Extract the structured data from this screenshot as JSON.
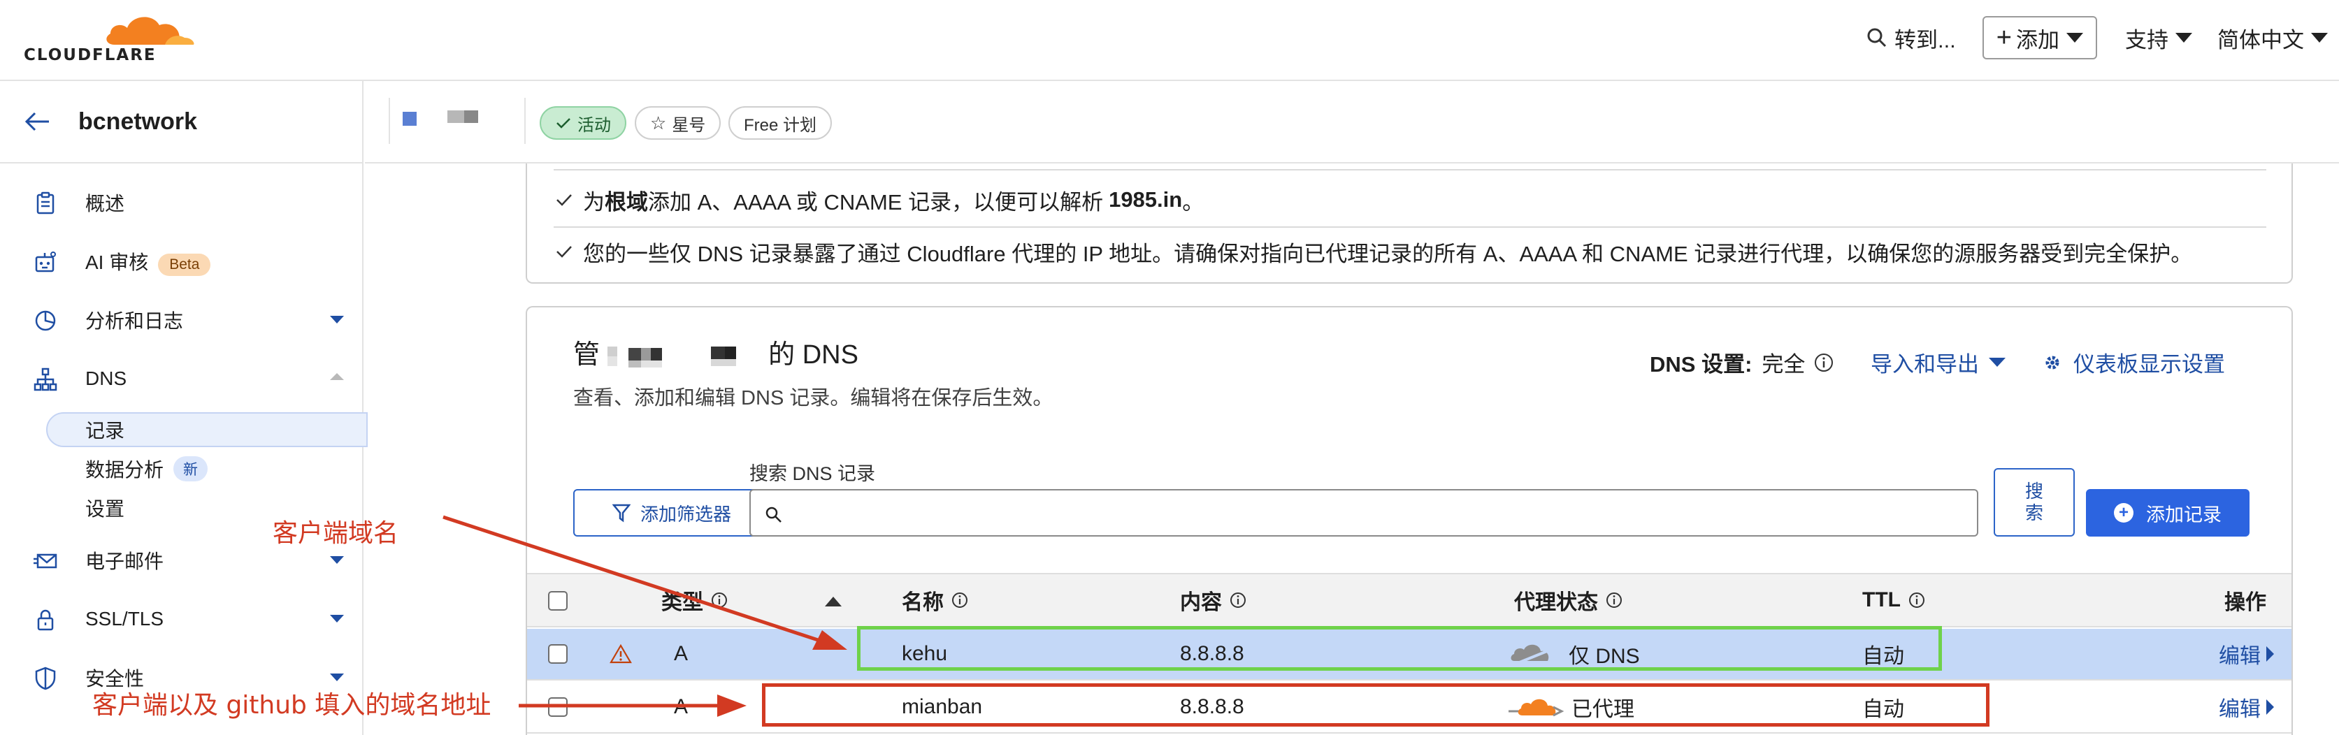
{
  "header": {
    "logo_text": "CLOUDFLARE",
    "goto_label": "转到...",
    "add_label": "添加",
    "support_label": "支持",
    "language_label": "简体中文",
    "colors": {
      "brand_orange": "#f38020",
      "link_blue": "#1f4ea3",
      "primary_button": "#2c64e0"
    }
  },
  "sidebar": {
    "account_name": "bcnetwork",
    "items": [
      {
        "label": "概述",
        "icon": "clipboard-icon"
      },
      {
        "label": "AI 审核",
        "icon": "robot-icon",
        "badge": "Beta"
      },
      {
        "label": "分析和日志",
        "icon": "pie-chart-icon"
      },
      {
        "label": "DNS",
        "icon": "network-icon"
      },
      {
        "label": "电子邮件",
        "icon": "envelope-icon"
      },
      {
        "label": "SSL/TLS",
        "icon": "lock-icon"
      },
      {
        "label": "安全性",
        "icon": "shield-icon"
      }
    ],
    "dns_sub": [
      {
        "label": "记录"
      },
      {
        "label": "数据分析",
        "badge": "新"
      },
      {
        "label": "设置"
      }
    ]
  },
  "zone": {
    "status_label": "活动",
    "star_label": "星号",
    "plan_label": "Free 计划"
  },
  "info": {
    "line1_pre": "为",
    "line1_bold1": "根域",
    "line1_mid": "添加 A、AAAA 或 CNAME 记录，以便可以解析",
    "line1_bold2": "1985.in",
    "line1_post": "。",
    "line2": "您的一些仅 DNS 记录暴露了通过 Cloudflare 代理的 IP 地址。请确保对指向已代理记录的所有 A、AAAA 和 CNAME 记录进行代理，以确保您的源服务器受到完全保护。"
  },
  "dns": {
    "title_pre": "管",
    "title_post": "的 DNS",
    "subtitle": "查看、添加和编辑 DNS 记录。编辑将在保存后生效。",
    "setting_label": "DNS 设置:",
    "setting_value": "完全",
    "import_export_label": "导入和导出",
    "dashboard_label": "仪表板显示设置",
    "filter_label": "添加筛选器",
    "search_label": "搜索 DNS 记录",
    "search_placeholder": "",
    "search_btn_line1": "搜",
    "search_btn_line2": "索",
    "add_record_label": "添加记录",
    "columns": {
      "type": "类型",
      "name": "名称",
      "content": "内容",
      "proxy": "代理状态",
      "ttl": "TTL",
      "actions": "操作"
    },
    "records": [
      {
        "type": "A",
        "name": "kehu",
        "content": "8.8.8.8",
        "proxy": "仅 DNS",
        "ttl": "自动",
        "edit": "编辑",
        "warning": true
      },
      {
        "type": "A",
        "name": "mianban",
        "content": "8.8.8.8",
        "proxy": "已代理",
        "ttl": "自动",
        "edit": "编辑",
        "warning": false
      }
    ]
  },
  "annotations": {
    "client_domain": "客户端域名",
    "client_github_domain": "客户端以及 github 填入的域名地址"
  }
}
